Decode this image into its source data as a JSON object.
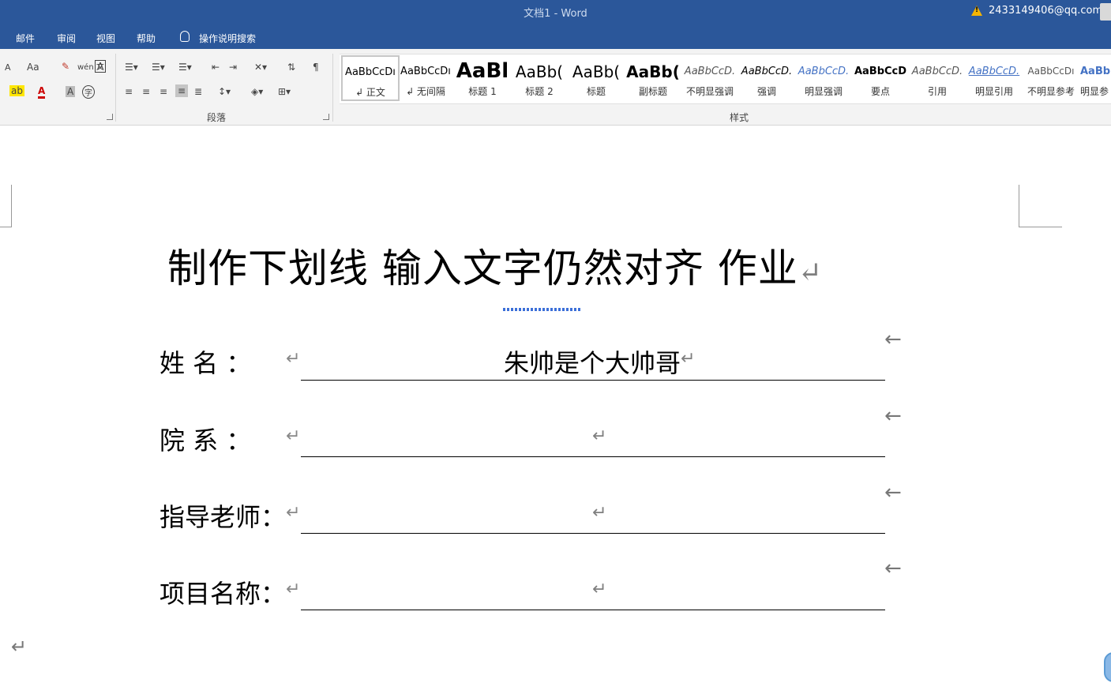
{
  "window": {
    "title": "文档1  -  Word",
    "user": "2433149406@qq.com"
  },
  "tabs": [
    "邮件",
    "审阅",
    "视图",
    "帮助"
  ],
  "tell_me": "操作说明搜索",
  "ribbon": {
    "font_group": {
      "grow_label": "A",
      "case_label": "Aa",
      "phonetic_label": "wén 文",
      "border_label": "A",
      "char_shading_label": "A",
      "enclose_label": "字"
    },
    "paragraph_label": "段落",
    "styles_label": "样式",
    "styles": [
      {
        "preview": "AaBbCcDı",
        "name": "↲ 正文"
      },
      {
        "preview": "AaBbCcDı",
        "name": "↲ 无间隔"
      },
      {
        "preview": "AaBl",
        "name": "标题 1"
      },
      {
        "preview": "AaBb(",
        "name": "标题 2"
      },
      {
        "preview": "AaBb(",
        "name": "标题"
      },
      {
        "preview": "AaBb(",
        "name": "副标题"
      },
      {
        "preview": "AaBbCcD.",
        "name": "不明显强调"
      },
      {
        "preview": "AaBbCcD.",
        "name": "强调"
      },
      {
        "preview": "AaBbCcD.",
        "name": "明显强调"
      },
      {
        "preview": "AaBbCcD",
        "name": "要点"
      },
      {
        "preview": "AaBbCcD.",
        "name": "引用"
      },
      {
        "preview": "AaBbCcD.",
        "name": "明显引用"
      },
      {
        "preview": "AaBbCcDı",
        "name": "不明显参考"
      },
      {
        "preview": "AaBb(",
        "name": "明显参"
      }
    ]
  },
  "document": {
    "heading": "制作下划线  输入文字仍然对齐  作业",
    "rows": [
      {
        "label": "姓    名  ：",
        "value": "朱帅是个大帅哥"
      },
      {
        "label": "院    系  ：",
        "value": ""
      },
      {
        "label": "指导老师：",
        "value": ""
      },
      {
        "label": "项目名称：",
        "value": ""
      }
    ],
    "paragraph_mark": "↵",
    "row_mark": "←"
  }
}
